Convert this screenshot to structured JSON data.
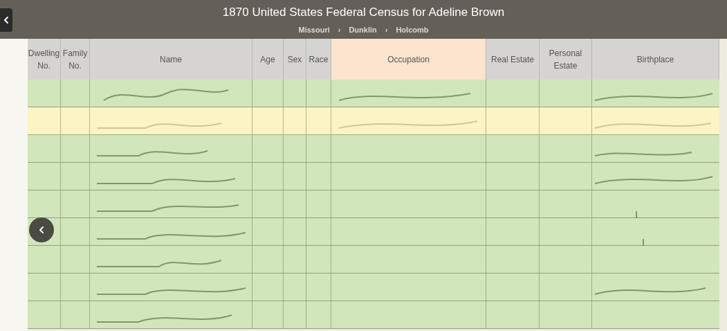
{
  "title_bar": {
    "title": "1870 United States Federal Census for Adeline Brown",
    "breadcrumb": [
      "Missouri",
      "Dunklin",
      "Holcomb"
    ],
    "separator": "›"
  },
  "columns": [
    {
      "label": "Dwelling No.",
      "selected": false
    },
    {
      "label": "Family No.",
      "selected": false
    },
    {
      "label": "Name",
      "selected": false
    },
    {
      "label": "Age",
      "selected": false
    },
    {
      "label": "Sex",
      "selected": false
    },
    {
      "label": "Race",
      "selected": false
    },
    {
      "label": "Occupation",
      "selected": true
    },
    {
      "label": "Real Estate",
      "selected": false
    },
    {
      "label": "Personal Estate",
      "selected": false
    },
    {
      "label": "Birthplace",
      "selected": false
    }
  ],
  "rows": [
    {
      "selected": false
    },
    {
      "selected": true
    },
    {
      "selected": false
    },
    {
      "selected": false
    },
    {
      "selected": false
    },
    {
      "selected": false
    },
    {
      "selected": false
    },
    {
      "selected": false
    },
    {
      "selected": false
    }
  ]
}
